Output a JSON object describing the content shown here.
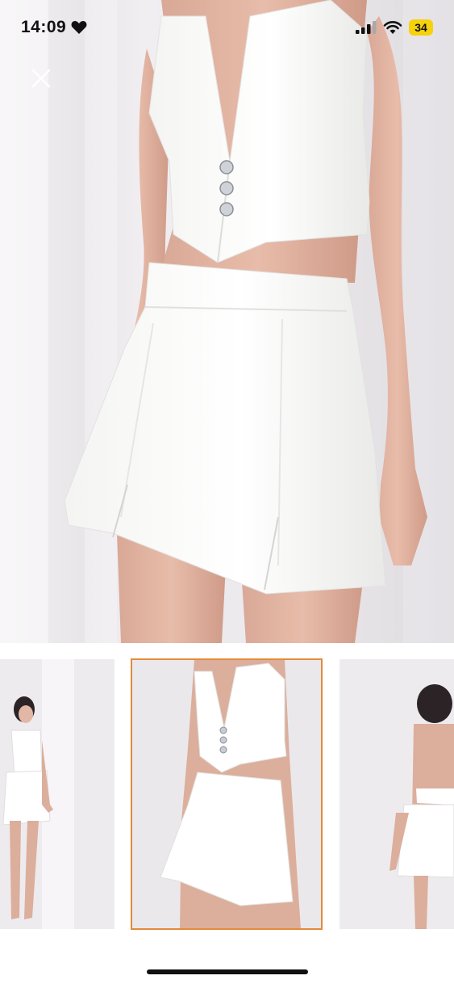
{
  "status_bar": {
    "time": "14:09",
    "battery_level": "34",
    "battery_color": "#f5d20c"
  },
  "close_button": {
    "icon": "close-icon"
  },
  "gallery": {
    "main_image": "white-halter-vest-top-and-mini-skort-front-closeup",
    "thumbnails": [
      {
        "image": "full-body-front-pose",
        "selected": false
      },
      {
        "image": "front-closeup",
        "selected": true
      },
      {
        "image": "back-view",
        "selected": false
      }
    ],
    "selected_outline_color": "#e48a3a"
  }
}
